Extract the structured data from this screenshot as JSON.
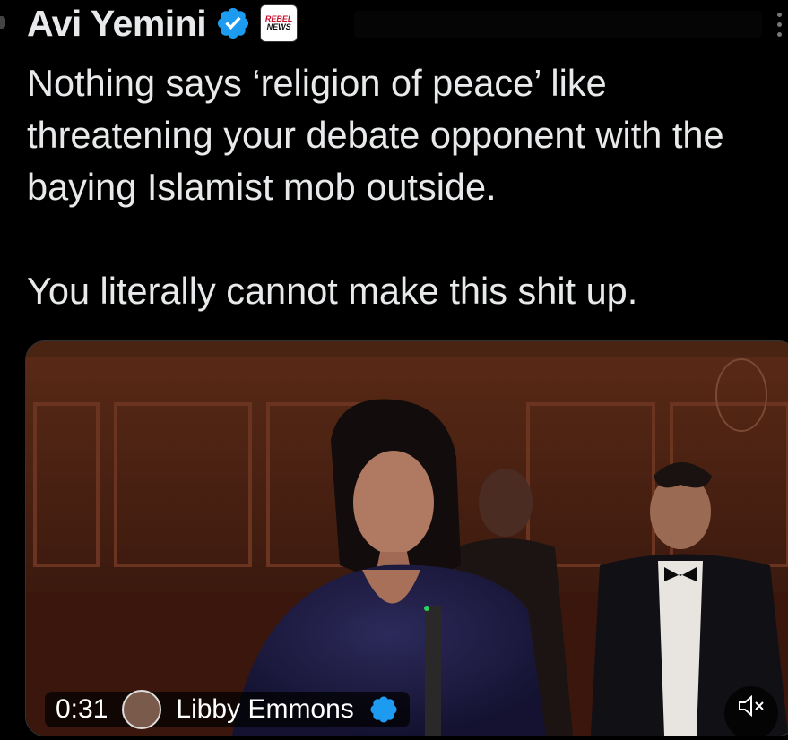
{
  "author": {
    "name": "Avi Yemini",
    "affiliation_badge": {
      "line1": "REBEL",
      "line2": "NEWS"
    }
  },
  "tweet": {
    "paragraph1": "Nothing says ‘religion of peace’ like threatening your debate opponent with the baying Islamist mob outside.",
    "paragraph2": "You literally cannot make this shit up."
  },
  "video": {
    "timestamp": "0:31",
    "author": "Libby Emmons",
    "icons": [
      "verified-icon",
      "mute-icon",
      "more-icon"
    ]
  },
  "colors": {
    "background": "#000000",
    "text": "#e7e9ea",
    "verified": "#1d9bf0",
    "rebel_red": "#c8102e"
  }
}
